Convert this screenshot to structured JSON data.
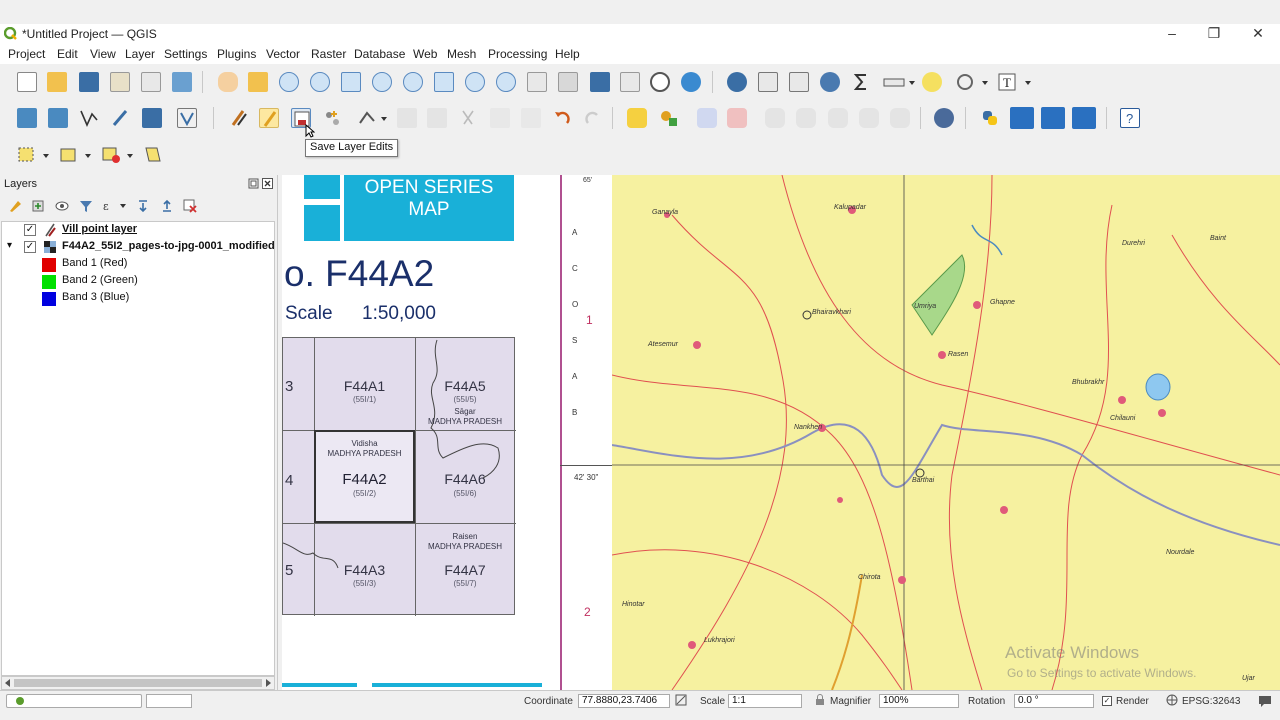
{
  "window": {
    "title": "*Untitled Project — QGIS",
    "minimize": "–",
    "restore": "❐",
    "close": "✕"
  },
  "menu": [
    "Project",
    "Edit",
    "View",
    "Layer",
    "Settings",
    "Plugins",
    "Vector",
    "Raster",
    "Database",
    "Web",
    "Mesh",
    "Processing",
    "Help"
  ],
  "tooltip": "Save Layer Edits",
  "layers_panel": {
    "title": "Layers",
    "layers": [
      {
        "name": "Vill point layer",
        "checked": "✓"
      },
      {
        "name": "F44A2_55I2_pages-to-jpg-0001_modified",
        "checked": "✓",
        "expander": "▾"
      }
    ],
    "bands": [
      {
        "name": "Band 1 (Red)",
        "color": "#e00000"
      },
      {
        "name": "Band 2 (Green)",
        "color": "#00e000"
      },
      {
        "name": "Band 3 (Blue)",
        "color": "#0000e0"
      }
    ]
  },
  "map": {
    "series_title_1": "OPEN SERIES",
    "series_title_2": "MAP",
    "sheet_no": "o. F44A2",
    "scale_label": "Scale",
    "scale_value": "1:50,000",
    "index_cells": [
      {
        "code": "3",
        "sub": ""
      },
      {
        "code": "F44A1",
        "sub": "(55I/1)"
      },
      {
        "code": "F44A5",
        "sub": "(55I/5)"
      },
      {
        "code": "4",
        "sub": ""
      },
      {
        "code": "F44A2",
        "sub": "(55I/2)"
      },
      {
        "code": "F44A6",
        "sub": "(55I/6)"
      },
      {
        "code": "5",
        "sub": ""
      },
      {
        "code": "F44A3",
        "sub": "(55I/3)"
      },
      {
        "code": "F44A7",
        "sub": "(55I/7)"
      }
    ],
    "index_places": {
      "sagar": "Sāgar",
      "mp1": "MADHYA PRADESH",
      "vidisha": "Vidisha",
      "mp2": "MADHYA PRADESH",
      "raisen": "Raisen",
      "mp3": "MADHYA PRADESH"
    },
    "ruler_labels": {
      "top": "65'",
      "one": "1",
      "mid_lat": "42' 30\"",
      "two": "2"
    },
    "places": [
      "Ganayla",
      "Kalupadar",
      "Durehri",
      "Baint",
      "Bhairavkhari",
      "Umriya",
      "Ghapne",
      "Atesemur",
      "Rasen",
      "Bhubrakhr",
      "Chilauni",
      "Nankheri",
      "Barthai",
      "Chirota",
      "Hinotar",
      "Lukhrajori",
      "Nourdale",
      "Ujar"
    ]
  },
  "watermark": {
    "line1": "Activate Windows",
    "line2": "Go to Settings to activate Windows."
  },
  "statusbar": {
    "coordinate_label": "Coordinate",
    "coordinate_value": "77.8880,23.7406",
    "scale_label": "Scale",
    "scale_value": "1:1",
    "magnifier_label": "Magnifier",
    "magnifier_value": "100%",
    "rotation_label": "Rotation",
    "rotation_value": "0.0 °",
    "render_label": "Render",
    "crs_label": "EPSG:32643"
  }
}
